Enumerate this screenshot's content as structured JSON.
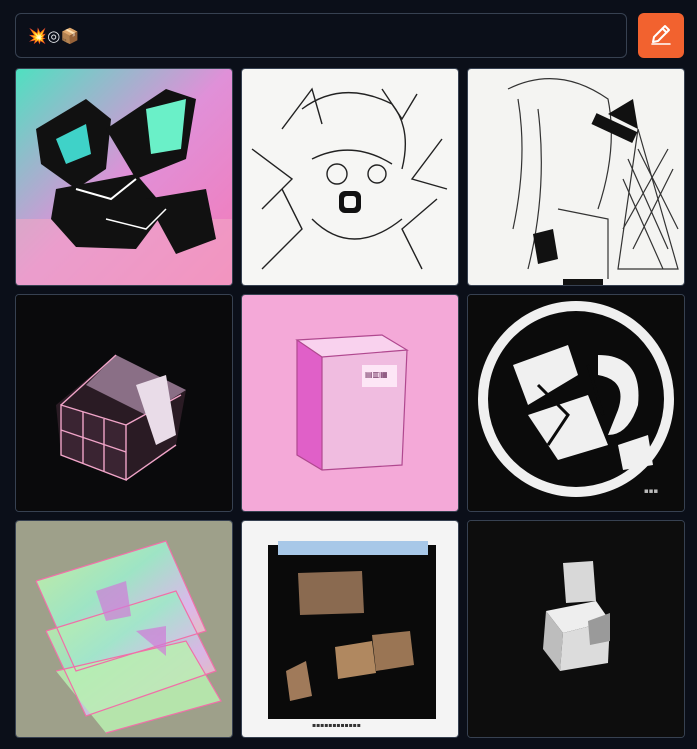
{
  "prompt": {
    "value": "💥◎📦"
  },
  "edit_button": {
    "icon": "pencil-icon",
    "color": "#f2622f"
  },
  "gallery": {
    "images": [
      {
        "name": "gallery-image-1",
        "style": "pastel teal pink geometric cube collage"
      },
      {
        "name": "gallery-image-2",
        "style": "black line sketch anime face"
      },
      {
        "name": "gallery-image-3",
        "style": "line sketch anime girl with bow"
      },
      {
        "name": "gallery-image-4",
        "style": "dark background pink wireframe box"
      },
      {
        "name": "gallery-image-5",
        "style": "pink carton box on pink background"
      },
      {
        "name": "gallery-image-6",
        "style": "black and white circular emblem"
      },
      {
        "name": "gallery-image-7",
        "style": "holographic layered papers"
      },
      {
        "name": "gallery-image-8",
        "style": "framed box with cardboard cubes"
      },
      {
        "name": "gallery-image-9",
        "style": "white box on black background"
      }
    ]
  },
  "colors": {
    "background": "#0b0f19",
    "border": "#374151",
    "accent": "#f2622f"
  }
}
